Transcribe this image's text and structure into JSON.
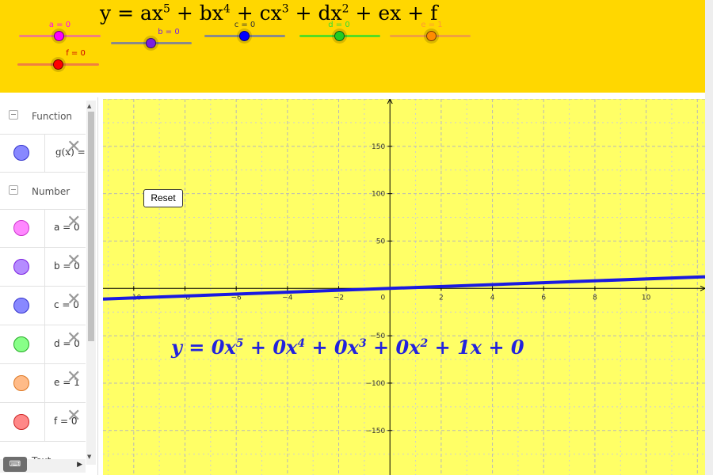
{
  "title": {
    "y": "y",
    "eq": " = ax",
    "p5": "5",
    "b": " + bx",
    "p4": "4",
    "c": " + cx",
    "p3": "3",
    "d": " + dx",
    "p2": "2",
    "rest": " + ex + f"
  },
  "sliders": [
    {
      "label": "a = 0",
      "color": "#FF00FF",
      "label_color": "#FF00FF",
      "track": "#F08080",
      "value": 0
    },
    {
      "label": "b = 0",
      "color": "#7B1FE0",
      "label_color": "#7B1FE0",
      "track": "#8a8a8a",
      "value": 0
    },
    {
      "label": "c = 0",
      "color": "#0000FF",
      "label_color": "#333333",
      "track": "#8a8a8a",
      "value": 0
    },
    {
      "label": "d = 0",
      "color": "#22CC22",
      "label_color": "#33DD33",
      "track": "#55DD22",
      "value": 0
    },
    {
      "label": "e = 1",
      "color": "#FF8C00",
      "label_color": "#FF9933",
      "track": "#F0A040",
      "value": 1
    },
    {
      "label": "f = 0",
      "color": "#FF0000",
      "label_color": "#CC0000",
      "track": "#F08040",
      "value": 0
    }
  ],
  "algebra": {
    "function_header": "Function",
    "function_row": {
      "text": "g(x) =",
      "color": "#8888FF"
    },
    "number_header": "Number",
    "number_rows": [
      {
        "text": "a = 0",
        "color": "#FF88FF",
        "border": "#CC33CC"
      },
      {
        "text": "b = 0",
        "color": "#B58CFF",
        "border": "#7B1FE0"
      },
      {
        "text": "c = 0",
        "color": "#8888FF",
        "border": "#3333CC"
      },
      {
        "text": "d = 0",
        "color": "#88FF88",
        "border": "#22AA22"
      },
      {
        "text": "e = 1",
        "color": "#FFBB88",
        "border": "#DD7722"
      },
      {
        "text": "f = 0",
        "color": "#FF8888",
        "border": "#CC2222"
      }
    ],
    "text_header": "Text"
  },
  "graphics": {
    "reset_label": "Reset",
    "polynomial": {
      "y": "y",
      "t1": " = 0x",
      "p5": "5",
      "t2": " + 0x",
      "p4": "4",
      "t3": " + 0x",
      "p3": "3",
      "t4": " + 0x",
      "p2": "2",
      "t5": " + 1x + 0"
    },
    "x_ticks": [
      -10,
      -8,
      -6,
      -4,
      -2,
      2,
      4,
      6,
      8,
      10
    ],
    "y_ticks": [
      150,
      100,
      50,
      -50,
      -100,
      -150
    ],
    "origin_label": "0",
    "curve_color": "#1A1AE0",
    "bg_color": "#FFFF66"
  },
  "chart_data": {
    "type": "line",
    "series": [
      {
        "name": "g(x)",
        "x": [
          -11.2,
          12.3
        ],
        "y": [
          -11.2,
          12.3
        ]
      }
    ],
    "xlim": [
      -11.2,
      12.3
    ],
    "ylim": [
      -197,
      200
    ],
    "grid": true
  }
}
